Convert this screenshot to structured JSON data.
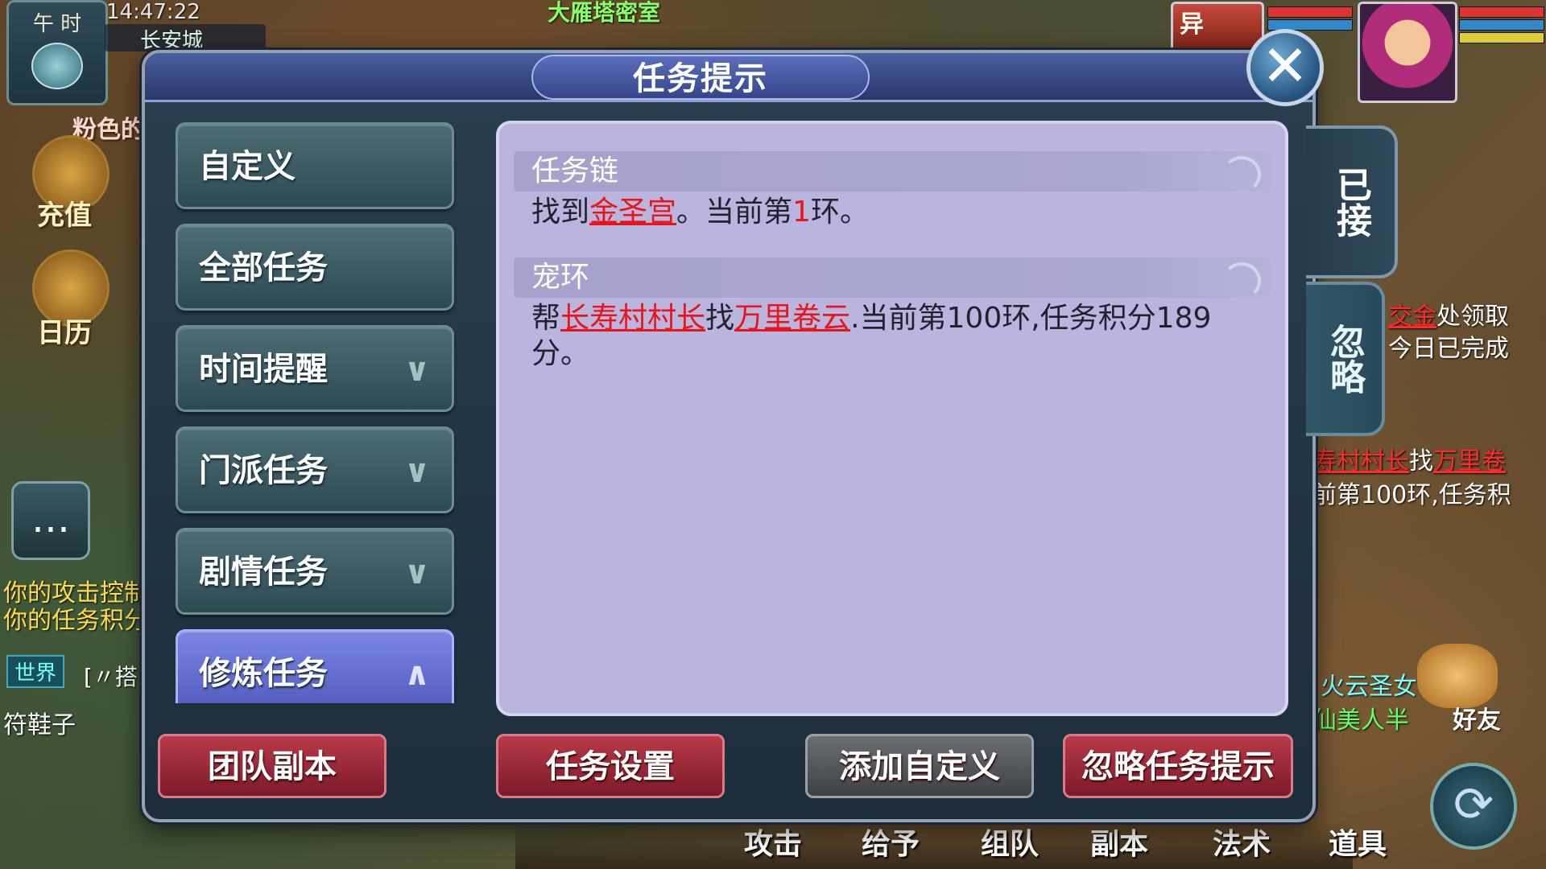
{
  "background": {
    "clock_label": "午 时",
    "time": "14:47:22",
    "city": "长安城",
    "top_banner": "大雁塔密室",
    "left_buttons": [
      {
        "label": "充值"
      },
      {
        "label": "日历"
      }
    ],
    "partial_label": "粉色的",
    "chat_lines": [
      "你的攻击控制",
      "你的任务积分"
    ],
    "world_tag": "世界",
    "world_text": "[〃搭",
    "sneaker_text": "符鞋子",
    "pet_badge": "异",
    "right_snippets": {
      "line1_red": "交金",
      "line1_rest": "处领取",
      "line2": "今日已完成",
      "line3_red": "寿村村长",
      "line3_mid": "找",
      "line3_red2": "万里卷",
      "line4": "前第100环,任务积",
      "npc_name": "火云圣女",
      "npc_title": "仙美人半",
      "friend": "好友"
    },
    "bottom_menu": [
      "攻击",
      "给予",
      "组队",
      "副本",
      "法术",
      "道具"
    ]
  },
  "dialog": {
    "title": "任务提示",
    "close_icon": "close-icon",
    "side_tabs": {
      "accepted": "已接",
      "ignored": "忽略"
    },
    "categories": [
      {
        "label": "自定义",
        "chevron": "",
        "active": false
      },
      {
        "label": "全部任务",
        "chevron": "",
        "active": false
      },
      {
        "label": "时间提醒",
        "chevron": "∨",
        "active": false
      },
      {
        "label": "门派任务",
        "chevron": "∨",
        "active": false
      },
      {
        "label": "剧情任务",
        "chevron": "∨",
        "active": false
      },
      {
        "label": "修炼任务",
        "chevron": "∧",
        "active": true
      }
    ],
    "sections": [
      {
        "heading": "任务链",
        "text_pre": "找到",
        "link1": "金圣宫",
        "text_mid": "。当前第",
        "number": "1",
        "text_post": "环。"
      },
      {
        "heading": "宠环",
        "text_pre": "帮",
        "link1": "长寿村村长",
        "text_mid": "找",
        "link2": "万里卷云",
        "text_post": ".当前第100环,任务积分189分。"
      }
    ],
    "buttons": {
      "team_dungeon": "团队副本",
      "task_settings": "任务设置",
      "add_custom": "添加自定义",
      "ignore_tips": "忽略任务提示"
    },
    "colors": {
      "panel": "#b9b5de",
      "link_red": "#e8161a",
      "active_tab": "#6a76d8",
      "red_button": "#9a2a38"
    }
  }
}
